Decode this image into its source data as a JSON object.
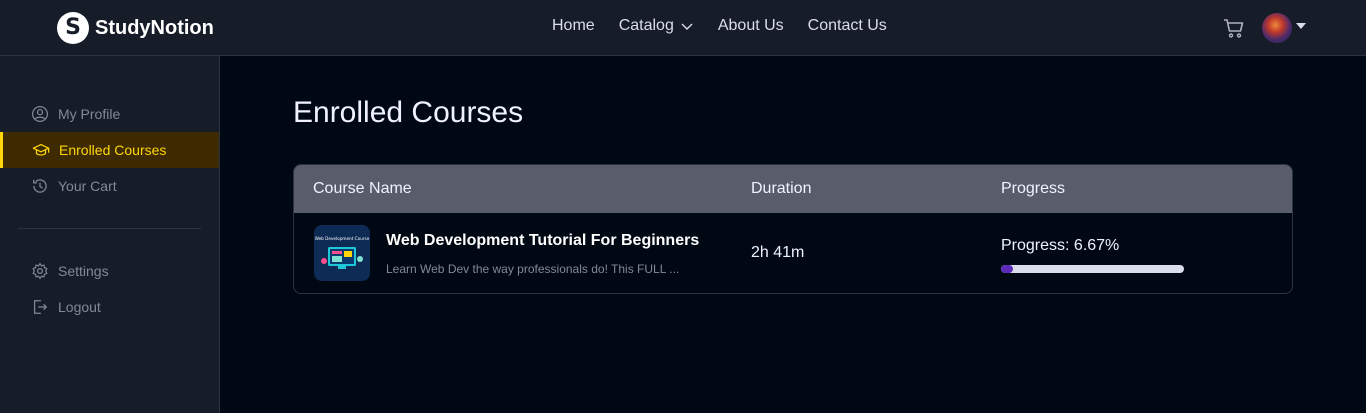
{
  "brand": {
    "name": "StudyNotion",
    "badge": "S"
  },
  "nav": {
    "links": [
      "Home",
      "Catalog",
      "About Us",
      "Contact Us"
    ]
  },
  "sidebar": {
    "items": [
      {
        "label": "My Profile",
        "icon": "profile-icon"
      },
      {
        "label": "Enrolled Courses",
        "icon": "graduation-cap-icon",
        "active": true
      },
      {
        "label": "Your Cart",
        "icon": "history-icon"
      },
      {
        "label": "Settings",
        "icon": "gear-icon"
      },
      {
        "label": "Logout",
        "icon": "logout-icon"
      }
    ]
  },
  "main": {
    "title": "Enrolled Courses",
    "table": {
      "headers": [
        "Course Name",
        "Duration",
        "Progress"
      ],
      "rows": [
        {
          "title": "Web Development Tutorial For Beginners",
          "description": "Learn Web Dev the way professionals do! This FULL ...",
          "thumbnail_text": "Web Development Course",
          "duration": "2h 41m",
          "progress_label": "Progress: 6.67%",
          "progress_value": 6.67
        }
      ]
    }
  },
  "colors": {
    "accent": "#ffd60a",
    "progress": "#5b2bb8",
    "background": "#000814",
    "panel": "#161d29"
  }
}
